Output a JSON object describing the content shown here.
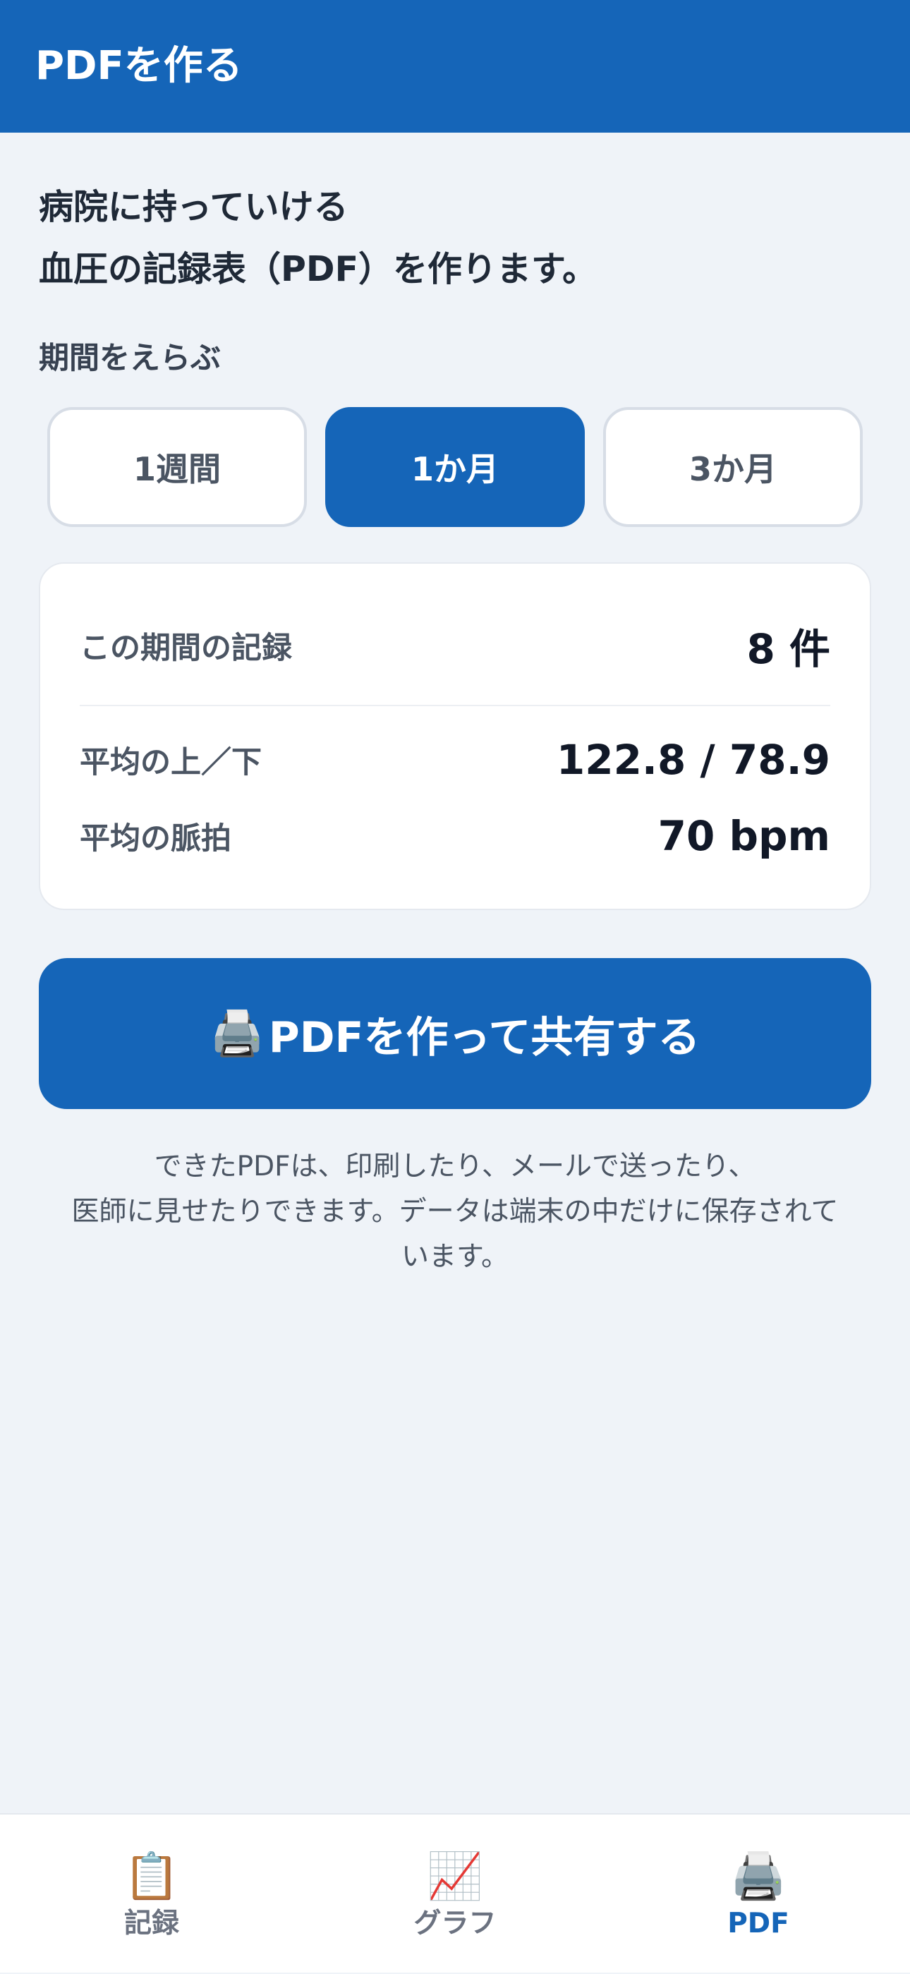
{
  "header": {
    "title": "PDFを作る"
  },
  "intro": {
    "line1": "病院に持っていける",
    "line2": "血圧の記録表（PDF）を作ります。"
  },
  "period": {
    "label": "期間をえらぶ",
    "options": [
      "1週間",
      "1か月",
      "3か月"
    ],
    "selected": "1か月"
  },
  "summary": {
    "records_label": "この期間の記録",
    "records_value": "8 件",
    "avg_bp_label": "平均の上／下",
    "avg_bp_value": "122.8 / 78.9",
    "avg_pulse_label": "平均の脈拍",
    "avg_pulse_value": "70 bpm"
  },
  "share_button": {
    "icon": "🖨️",
    "label": "PDFを作って共有する"
  },
  "note": {
    "line1": "できたPDFは、印刷したり、メールで送ったり、",
    "line2": "医師に見せたりできます。データは端末の中だけに保存されて",
    "line3": "います。"
  },
  "tabs": [
    {
      "icon": "📋",
      "icon_name": "clipboard-icon",
      "label": "記録"
    },
    {
      "icon": "📈",
      "icon_name": "chart-icon",
      "label": "グラフ"
    },
    {
      "icon": "🖨️",
      "icon_name": "printer-icon",
      "label": "PDF"
    }
  ],
  "active_tab": "PDF",
  "colors": {
    "accent": "#1565b8",
    "background": "#eff3f8"
  }
}
